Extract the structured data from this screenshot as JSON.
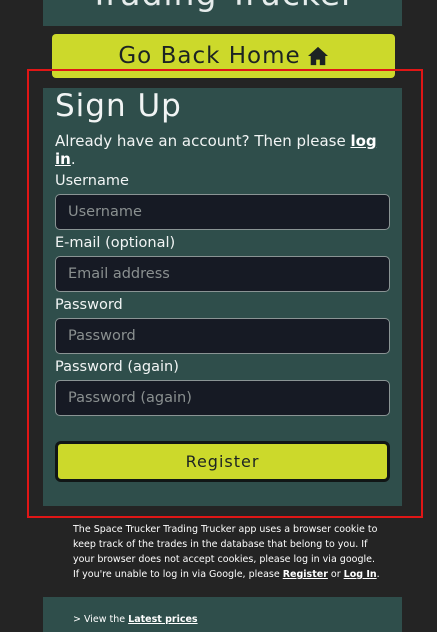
{
  "header": {
    "title": "Trading Trucker"
  },
  "home_button": {
    "label": "Go Back Home",
    "icon": "home-icon"
  },
  "signup": {
    "title": "Sign Up",
    "login_prompt_prefix": "Already have an account? Then please ",
    "login_link": "log in",
    "login_prompt_suffix": ".",
    "fields": [
      {
        "label": "Username",
        "placeholder": "Username",
        "value": ""
      },
      {
        "label": "E-mail (optional)",
        "placeholder": "Email address",
        "value": ""
      },
      {
        "label": "Password",
        "placeholder": "Password",
        "value": ""
      },
      {
        "label": "Password (again)",
        "placeholder": "Password (again)",
        "value": ""
      }
    ],
    "register_label": "Register"
  },
  "cookie_notice": {
    "text": "The Space Trucker Trading Trucker app uses a browser cookie to keep track of the trades in the database that belong to you. If your browser does not accept cookies, please log in via google. If you're unable to log in via Google, please ",
    "register_link": "Register",
    "or": " or ",
    "login_link": "Log In",
    "end": "."
  },
  "footer": {
    "prefix": "> View the ",
    "latest_prices_link": "Latest prices"
  },
  "colors": {
    "background": "#242424",
    "panel": "#2f4e4b",
    "accent": "#ccd92b",
    "highlight": "#e01616",
    "input_bg": "#161a24"
  }
}
